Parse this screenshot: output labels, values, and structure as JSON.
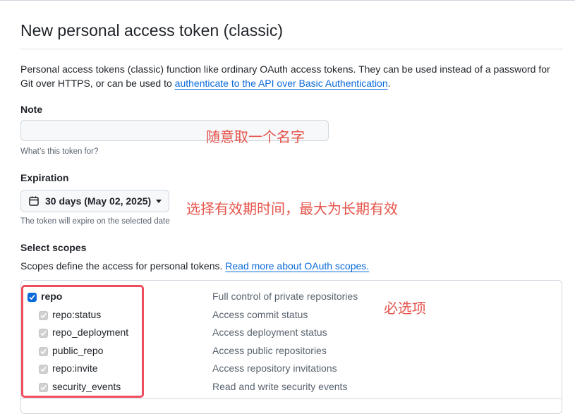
{
  "page": {
    "title": "New personal access token (classic)",
    "description_before_link": "Personal access tokens (classic) function like ordinary OAuth access tokens. They can be used instead of a password for Git over HTTPS, or can be used to ",
    "description_link": "authenticate to the API over Basic Authentication",
    "description_after_link": "."
  },
  "note": {
    "label": "Note",
    "value": "",
    "hint": "What’s this token for?",
    "annotation": "随意取一个名字"
  },
  "expiration": {
    "label": "Expiration",
    "selected": "30 days (May 02, 2025)",
    "hint": "The token will expire on the selected date",
    "annotation": "选择有效期时间，最大为长期有效"
  },
  "scopes": {
    "label": "Select scopes",
    "description": "Scopes define the access for personal tokens. ",
    "link": "Read more about OAuth scopes.",
    "annotation": "必选项",
    "items": [
      {
        "name": "repo",
        "desc": "Full control of private repositories",
        "checked": true,
        "parent": true
      },
      {
        "name": "repo:status",
        "desc": "Access commit status",
        "checked": true,
        "parent": false
      },
      {
        "name": "repo_deployment",
        "desc": "Access deployment status",
        "checked": true,
        "parent": false
      },
      {
        "name": "public_repo",
        "desc": "Access public repositories",
        "checked": true,
        "parent": false
      },
      {
        "name": "repo:invite",
        "desc": "Access repository invitations",
        "checked": true,
        "parent": false
      },
      {
        "name": "security_events",
        "desc": "Read and write security events",
        "checked": true,
        "parent": false
      }
    ]
  },
  "colors": {
    "accent": "#0969da",
    "annotation": "#e5544b",
    "highlight_box": "#ef4d5e"
  }
}
